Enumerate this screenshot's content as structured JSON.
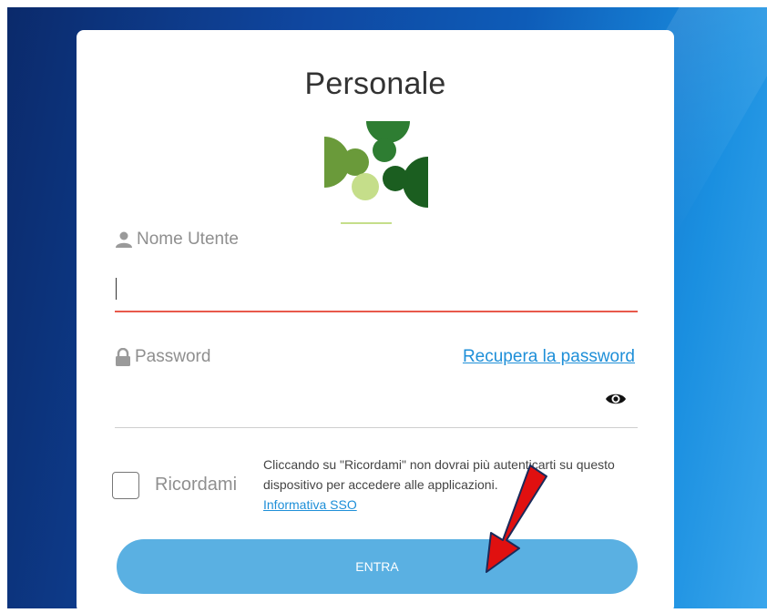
{
  "login": {
    "title": "Personale",
    "username_label": "Nome Utente",
    "username_value": "",
    "password_label": "Password",
    "password_value": "",
    "recover_link": "Recupera la password",
    "remember_label": "Ricordami",
    "remember_note": "Cliccando su \"Ricordami\" non dovrai più autenticarti su questo dispositivo per accedere alle applicazioni.",
    "sso_link": "Informativa SSO",
    "submit_label": "ENTRA"
  },
  "icons": {
    "user": "user-icon",
    "lock": "lock-icon",
    "eye": "eye-icon",
    "arrow": "red-arrow-annotation"
  },
  "colors": {
    "accent": "#1e8fd8",
    "button": "#5ab0e2",
    "error_underline": "#e8594b",
    "annotation": "#e01010",
    "logo_greens": [
      "#2e7d32",
      "#1b5e20",
      "#6a9a3a",
      "#c5de8a"
    ]
  }
}
